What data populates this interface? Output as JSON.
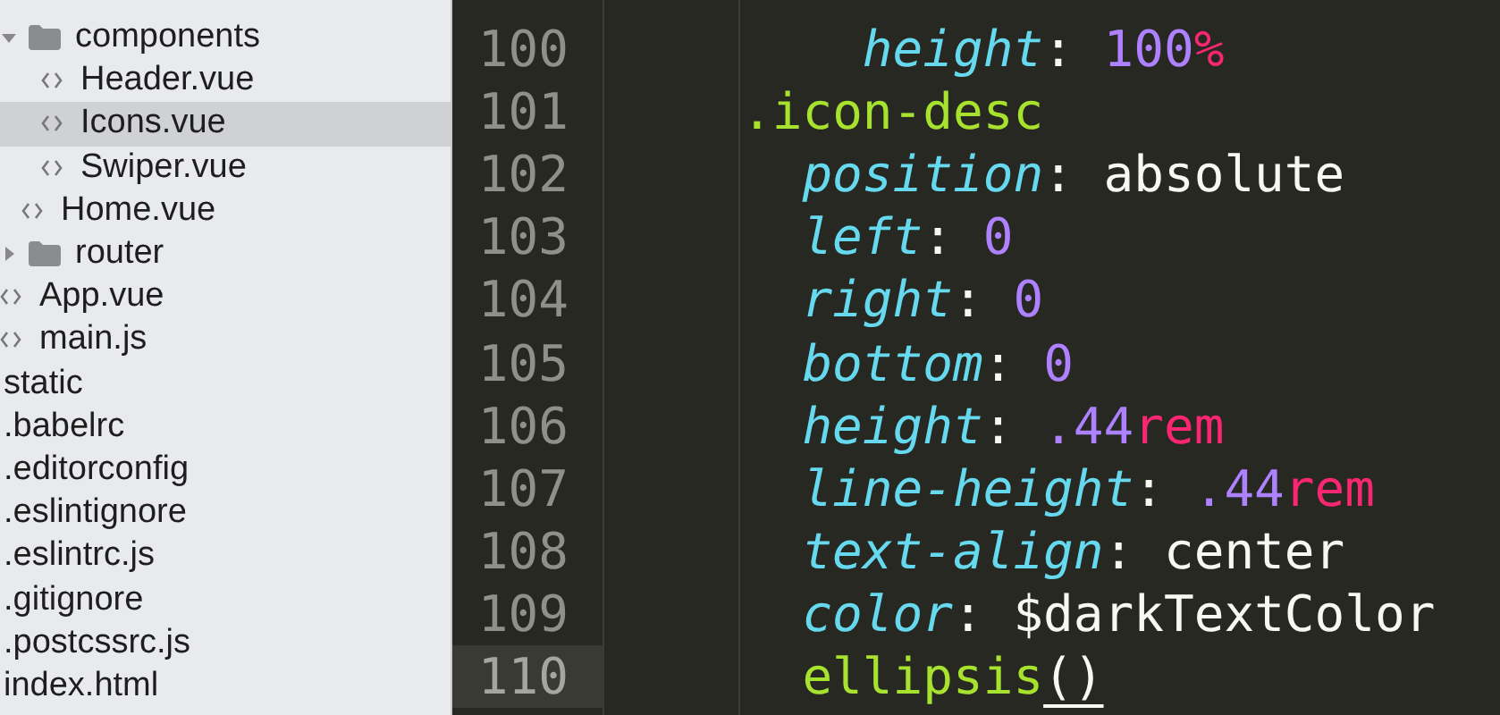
{
  "sidebar": {
    "tree": [
      {
        "children": [
          {
            "children": [
              {
                "name": "components",
                "kind": "folder",
                "expanded": true,
                "selected": false,
                "children": [
                  {
                    "name": "Header.vue",
                    "kind": "file",
                    "selected": false
                  },
                  {
                    "name": "Icons.vue",
                    "kind": "file",
                    "selected": true
                  },
                  {
                    "name": "Swiper.vue",
                    "kind": "file",
                    "selected": false
                  }
                ]
              },
              {
                "name": "Home.vue",
                "kind": "file",
                "selected": false
              }
            ]
          },
          {
            "name": "router",
            "kind": "folder",
            "expanded": false,
            "selected": false
          },
          {
            "name": "App.vue",
            "kind": "file",
            "selected": false
          },
          {
            "name": "main.js",
            "kind": "file",
            "selected": false
          }
        ]
      },
      {
        "name": "static",
        "selected": false
      },
      {
        "name": ".babelrc",
        "selected": false
      },
      {
        "name": ".editorconfig",
        "selected": false
      },
      {
        "name": ".eslintignore",
        "selected": false
      },
      {
        "name": ".eslintrc.js",
        "selected": false
      },
      {
        "name": ".gitignore",
        "selected": false
      },
      {
        "name": ".postcssrc.js",
        "selected": false
      },
      {
        "name": "index.html",
        "selected": false
      }
    ]
  },
  "editor": {
    "lines": [
      {
        "children": [
          {
            "children": [
              {
                "number": "100",
                "current": false,
                "tokens": [
                  {
                    "kind": "prop",
                    "text": "height"
                  },
                  {
                    "kind": "punct",
                    "text": ": "
                  },
                  {
                    "kind": "num",
                    "text": "100"
                  },
                  {
                    "kind": "unit",
                    "text": "%"
                  }
                ]
              }
            ]
          }
        ]
      },
      {
        "number": "101",
        "current": false,
        "tokens": [
          {
            "kind": "selector",
            "text": ".icon-desc"
          }
        ],
        "children": [
          {
            "number": "102",
            "current": false,
            "tokens": [
              {
                "kind": "prop",
                "text": "position"
              },
              {
                "kind": "punct",
                "text": ": "
              },
              {
                "kind": "value",
                "text": "absolute"
              }
            ]
          },
          {
            "number": "103",
            "current": false,
            "tokens": [
              {
                "kind": "prop",
                "text": "left"
              },
              {
                "kind": "punct",
                "text": ": "
              },
              {
                "kind": "num",
                "text": "0"
              }
            ]
          },
          {
            "number": "104",
            "current": false,
            "tokens": [
              {
                "kind": "prop",
                "text": "right"
              },
              {
                "kind": "punct",
                "text": ": "
              },
              {
                "kind": "num",
                "text": "0"
              }
            ]
          },
          {
            "number": "105",
            "current": false,
            "tokens": [
              {
                "kind": "prop",
                "text": "bottom"
              },
              {
                "kind": "punct",
                "text": ": "
              },
              {
                "kind": "num",
                "text": "0"
              }
            ]
          },
          {
            "number": "106",
            "current": false,
            "tokens": [
              {
                "kind": "prop",
                "text": "height"
              },
              {
                "kind": "punct",
                "text": ": "
              },
              {
                "kind": "num",
                "text": ".44"
              },
              {
                "kind": "unit",
                "text": "rem"
              }
            ]
          },
          {
            "number": "107",
            "current": false,
            "tokens": [
              {
                "kind": "prop",
                "text": "line-height"
              },
              {
                "kind": "punct",
                "text": ": "
              },
              {
                "kind": "num",
                "text": ".44"
              },
              {
                "kind": "unit",
                "text": "rem"
              }
            ]
          },
          {
            "number": "108",
            "current": false,
            "tokens": [
              {
                "kind": "prop",
                "text": "text-align"
              },
              {
                "kind": "punct",
                "text": ": "
              },
              {
                "kind": "value",
                "text": "center"
              }
            ]
          },
          {
            "number": "109",
            "current": false,
            "tokens": [
              {
                "kind": "prop",
                "text": "color"
              },
              {
                "kind": "punct",
                "text": ": "
              },
              {
                "kind": "value",
                "text": "$darkTextColor"
              }
            ]
          },
          {
            "number": "110",
            "current": true,
            "tokens": [
              {
                "kind": "func",
                "text": "ellipsis"
              },
              {
                "kind": "punct",
                "text": "()",
                "matched": true
              }
            ]
          }
        ]
      }
    ]
  }
}
